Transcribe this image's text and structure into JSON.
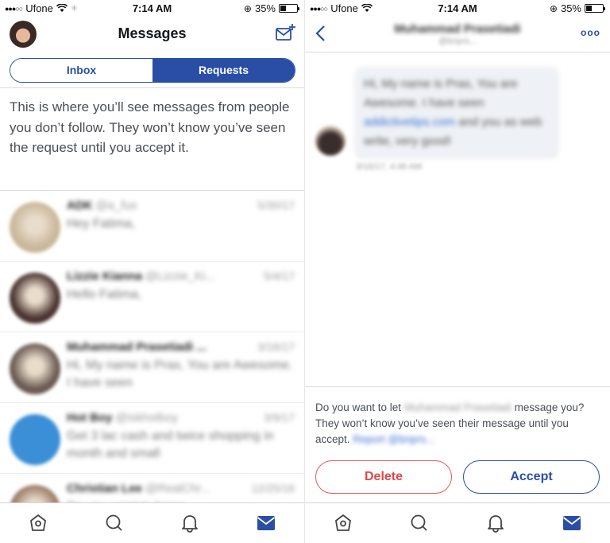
{
  "status_bar": {
    "signal": "●●●○○",
    "carrier": "Ufone",
    "time": "7:14 AM",
    "battery_percent_label": "35%",
    "battery_level": 0.35
  },
  "left_screen": {
    "title": "Messages",
    "tabs": [
      {
        "label": "Inbox",
        "active": false
      },
      {
        "label": "Requests",
        "active": true
      }
    ],
    "info_text": "This is where you’ll see messages from people you don’t follow. They won’t know you’ve seen the request until you accept it.",
    "requests": [
      {
        "name": "ADK",
        "handle": "@a_fus",
        "date": "5/30/17",
        "preview": "Hey Fatima,",
        "avatar_color": "#c9b79a"
      },
      {
        "name": "Lizzie Kianna",
        "handle": "@Lizzie_Ki...",
        "date": "5/4/17",
        "preview": "Hello Fatima,",
        "avatar_color": "#4a3330"
      },
      {
        "name": "Muhammad Prasetiadi ...",
        "handle": "",
        "date": "3/16/17",
        "preview": "Hi, My name is Pras, You are Awesome. I have seen",
        "avatar_color": "#6a5a52"
      },
      {
        "name": "Hot Boy",
        "handle": "@iskhotboy",
        "date": "3/9/17",
        "preview": "Get 3 lac cash and twice shopping in month and small",
        "avatar_color": "#3a8fd6"
      },
      {
        "name": "Christian Lee",
        "handle": "@RealChr...",
        "date": "12/25/16",
        "preview": "Do you want to know ...",
        "avatar_color": "#9a7a66"
      }
    ]
  },
  "right_screen": {
    "contact_name": "Muhammad Prasetiadi",
    "contact_handle": "@bnprs...",
    "message": {
      "text_before_link": "Hi, My name is Pras, You are Awesome. I have seen ",
      "link": "addictivetips.com",
      "text_after_link": " and you as web write, very good!",
      "timestamp": "3/16/17, 4:46 AM"
    },
    "prompt": {
      "part1": "Do you want to let ",
      "blurred_name": "Muhammad Prasetiadi",
      "part2": " message you? They won’t know you’ve seen their message until you accept. ",
      "report_link": "Report @bnprs..."
    },
    "delete_label": "Delete",
    "accept_label": "Accept"
  },
  "tab_bar": {
    "items": [
      {
        "icon": "home-icon",
        "active": false
      },
      {
        "icon": "search-icon",
        "active": false
      },
      {
        "icon": "bell-icon",
        "active": false
      },
      {
        "icon": "mail-icon",
        "active": true
      }
    ]
  },
  "colors": {
    "accent": "#2a4ea6",
    "danger": "#e0474b",
    "text_secondary": "#4a4f55",
    "icon_gray": "#555555"
  }
}
